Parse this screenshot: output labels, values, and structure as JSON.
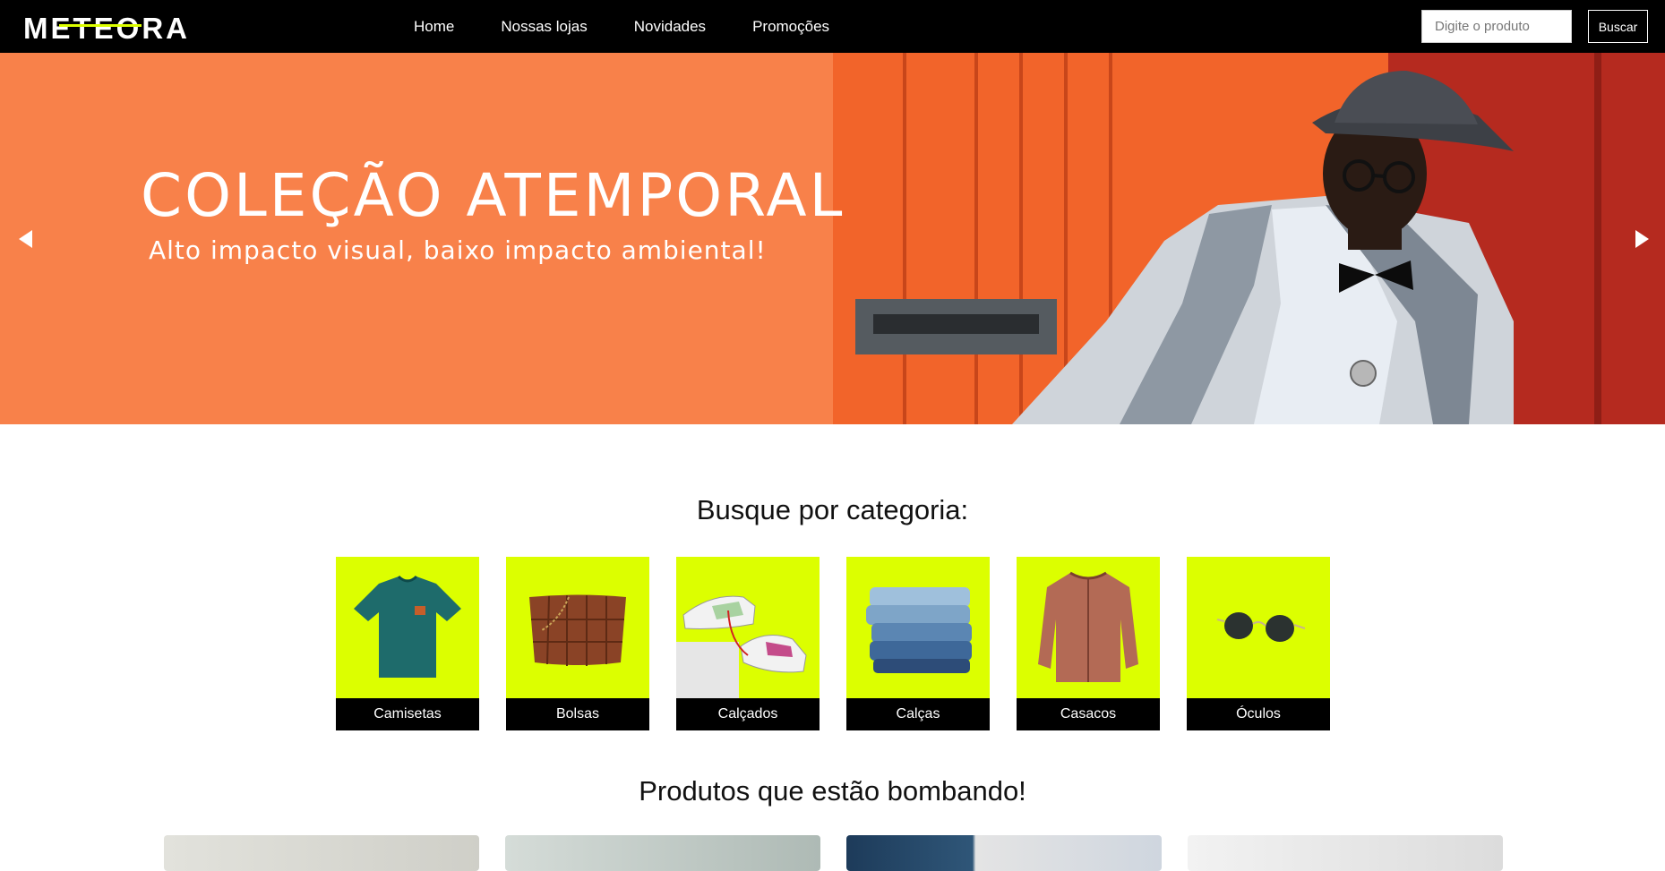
{
  "header": {
    "logo_text": "METEORA",
    "nav_items": [
      {
        "label": "Home"
      },
      {
        "label": "Nossas lojas"
      },
      {
        "label": "Novidades"
      },
      {
        "label": "Promoções"
      }
    ],
    "search_placeholder": "Digite o produto",
    "search_button_label": "Buscar"
  },
  "hero": {
    "title": "COLEÇÃO ATEMPORAL",
    "subtitle": "Alto impacto visual, baixo impacto ambiental!",
    "prev_icon": "chevron-left-icon",
    "next_icon": "chevron-right-icon"
  },
  "categories": {
    "title": "Busque por categoria:",
    "items": [
      {
        "label": "Camisetas",
        "icon": "tshirt-icon"
      },
      {
        "label": "Bolsas",
        "icon": "bag-icon"
      },
      {
        "label": "Calçados",
        "icon": "sneakers-icon"
      },
      {
        "label": "Calças",
        "icon": "jeans-icon"
      },
      {
        "label": "Casacos",
        "icon": "jacket-icon"
      },
      {
        "label": "Óculos",
        "icon": "sunglasses-icon"
      }
    ]
  },
  "products": {
    "title": "Produtos que estão bombando!"
  },
  "colors": {
    "nav_bg": "#000000",
    "hero_orange": "#f8814a",
    "category_bg": "#dcff00",
    "logo_accent": "#dcff00"
  }
}
